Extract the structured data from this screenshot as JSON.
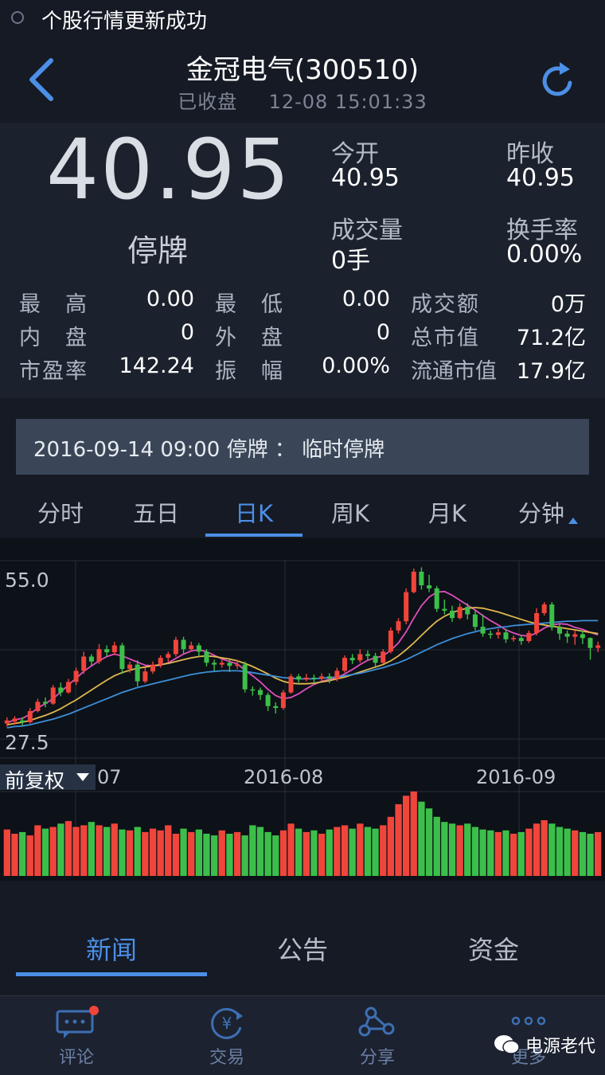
{
  "status_bar": {
    "message": "个股行情更新成功"
  },
  "header": {
    "title": "金冠电气(300510)",
    "status": "已收盘",
    "datetime": "12-08 15:01:33"
  },
  "quote": {
    "price": "40.95",
    "state": "停牌",
    "today_open_label": "今开",
    "today_open": "40.95",
    "prev_close_label": "昨收",
    "prev_close": "40.95",
    "volume_label": "成交量",
    "volume": "0手",
    "turnover_rate_label": "换手率",
    "turnover_rate": "0.00%"
  },
  "stats": [
    {
      "label": "最　高",
      "value": "0.00"
    },
    {
      "label": "最　低",
      "value": "0.00"
    },
    {
      "label": "成交额",
      "value": "0万"
    },
    {
      "label": "内　盘",
      "value": "0"
    },
    {
      "label": "外　盘",
      "value": "0"
    },
    {
      "label": "总市值",
      "value": "71.2亿"
    },
    {
      "label": "市盈率",
      "value": "142.24"
    },
    {
      "label": "振　幅",
      "value": "0.00%"
    },
    {
      "label": "流通市值",
      "value": "17.9亿"
    }
  ],
  "notice": {
    "date": "2016-09-14 09:00",
    "label": "停牌",
    "sep": "：",
    "text": "临时停牌"
  },
  "chart_tabs": [
    "分时",
    "五日",
    "日K",
    "周K",
    "月K",
    "分钟"
  ],
  "chart_tab_active": "日K",
  "chart_data": {
    "type": "bar",
    "ylabels": [
      "55.0",
      "27.5"
    ],
    "ylim": [
      27.5,
      55.0
    ],
    "xlabels": [
      "07",
      "2016-08",
      "2016-09"
    ],
    "candles": [
      [
        30,
        30.5,
        29.5,
        31
      ],
      [
        30.3,
        30.8,
        29.8,
        31.2
      ],
      [
        30.5,
        30.2,
        29.6,
        31
      ],
      [
        30.2,
        32,
        30,
        32.5
      ],
      [
        32,
        33.5,
        31.8,
        34
      ],
      [
        33.5,
        33.2,
        32.6,
        34.2
      ],
      [
        33.2,
        35.8,
        33,
        36.2
      ],
      [
        35.8,
        35,
        34.4,
        36.6
      ],
      [
        35,
        36.7,
        34.8,
        37.2
      ],
      [
        36.7,
        38.5,
        36.2,
        39
      ],
      [
        38.5,
        40.8,
        38,
        41.6
      ],
      [
        40.8,
        40,
        39.3,
        41.2
      ],
      [
        40,
        42,
        39.6,
        42.8
      ],
      [
        42,
        41.5,
        40.8,
        42.6
      ],
      [
        41.5,
        42.6,
        41,
        43.2
      ],
      [
        42.6,
        38.8,
        38,
        43
      ],
      [
        38.8,
        39.5,
        38.2,
        40
      ],
      [
        39.5,
        36.8,
        36,
        40.2
      ],
      [
        36.8,
        38.4,
        36.5,
        39
      ],
      [
        38.4,
        39.5,
        38,
        40
      ],
      [
        39.5,
        40.6,
        39,
        41
      ],
      [
        40.6,
        41.2,
        40,
        41.6
      ],
      [
        41.2,
        43.5,
        40.8,
        44
      ],
      [
        43.5,
        42,
        41.2,
        44
      ],
      [
        42,
        42.6,
        41.6,
        43.2
      ],
      [
        42.6,
        41.6,
        40.8,
        43
      ],
      [
        41.6,
        39.8,
        39.2,
        42
      ],
      [
        39.8,
        39.5,
        38.5,
        40.3
      ],
      [
        39.5,
        39.8,
        39,
        40.3
      ],
      [
        39.8,
        39.3,
        38.3,
        40.3
      ],
      [
        39.3,
        39.5,
        38.8,
        40.3
      ],
      [
        39.5,
        35.5,
        35,
        40
      ],
      [
        35.5,
        35.4,
        34.5,
        36
      ],
      [
        35.4,
        34.6,
        33.8,
        35.8
      ],
      [
        34.6,
        32.8,
        32,
        35
      ],
      [
        32.8,
        32.5,
        31.6,
        33.4
      ],
      [
        32.5,
        35,
        32.2,
        35.4
      ],
      [
        35,
        37.6,
        34.8,
        38
      ],
      [
        37.6,
        37.1,
        36.6,
        38
      ],
      [
        37.1,
        37.4,
        36.8,
        38
      ],
      [
        37.4,
        37.2,
        36.5,
        37.9
      ],
      [
        37.2,
        37.6,
        36.8,
        38.1
      ],
      [
        37.6,
        37.2,
        36.5,
        38.1
      ],
      [
        37.2,
        38.5,
        36.8,
        39
      ],
      [
        38.5,
        40.6,
        38.2,
        41
      ],
      [
        40.6,
        40.2,
        39.6,
        41.2
      ],
      [
        40.2,
        41.2,
        39.8,
        42
      ],
      [
        41.2,
        40.9,
        40.2,
        41.8
      ],
      [
        40.9,
        39.8,
        39.2,
        41.4
      ],
      [
        39.8,
        41.6,
        39.6,
        42
      ],
      [
        41.6,
        45,
        41.3,
        45.5
      ],
      [
        45,
        46.5,
        44.5,
        47
      ],
      [
        46.5,
        51.2,
        46,
        51.8
      ],
      [
        51.2,
        54.5,
        51,
        55
      ],
      [
        54.5,
        52.3,
        51.6,
        55.2
      ],
      [
        52.3,
        51.8,
        51.2,
        54
      ],
      [
        51.8,
        48.5,
        48,
        52.2
      ],
      [
        48.5,
        48.2,
        47.6,
        50
      ],
      [
        48.2,
        47,
        46.4,
        49
      ],
      [
        47,
        48.8,
        46.8,
        49.4
      ],
      [
        48.8,
        47.6,
        46.8,
        49.4
      ],
      [
        47.6,
        45.6,
        45,
        48.2
      ],
      [
        45.6,
        44.5,
        44,
        47.6
      ],
      [
        44.5,
        44.3,
        43.7,
        45
      ],
      [
        44.3,
        44.7,
        43.7,
        45.3
      ],
      [
        44.7,
        43.6,
        43,
        45.3
      ],
      [
        43.6,
        43.8,
        43.2,
        44.2
      ],
      [
        43.8,
        43.3,
        42.7,
        44.3
      ],
      [
        43.3,
        44.6,
        43,
        45
      ],
      [
        44.6,
        47.8,
        44.2,
        48.6
      ],
      [
        47.8,
        49.2,
        47.4,
        49.6
      ],
      [
        49.2,
        45.5,
        45,
        49.6
      ],
      [
        45.5,
        44.5,
        43.5,
        46
      ],
      [
        44.5,
        44,
        43,
        45
      ],
      [
        44,
        44.4,
        42.7,
        45
      ],
      [
        44.4,
        43.8,
        42.8,
        45
      ],
      [
        43.8,
        42.2,
        40.3,
        43.9
      ],
      [
        42.2,
        42.6,
        41.5,
        43.2
      ]
    ],
    "ma_series": [
      {
        "color": "#e04fbe",
        "values": [
          30.1,
          30.6,
          30.8,
          31.5,
          32.5,
          33.2,
          34.0,
          35.1,
          36.2,
          37.3,
          38.4,
          39.3,
          40.1,
          40.8,
          41.2,
          40.9,
          40.4,
          39.9,
          39.4,
          39.3,
          39.4,
          39.8,
          40.5,
          41.2,
          41.7,
          41.9,
          41.6,
          41.0,
          40.4,
          40.0,
          39.6,
          38.6,
          37.7,
          36.7,
          35.5,
          34.5,
          34.0,
          34.2,
          34.8,
          35.6,
          36.3,
          36.8,
          37.1,
          37.4,
          38.0,
          38.7,
          39.5,
          40.2,
          40.6,
          40.9,
          41.8,
          43.0,
          44.8,
          47.0,
          49.0,
          50.4,
          51.2,
          51.3,
          50.7,
          49.9,
          49.1,
          48.3,
          47.4,
          46.6,
          45.9,
          45.1,
          44.6,
          44.2,
          44.1,
          44.6,
          45.4,
          45.9,
          46.1,
          46.0,
          45.5,
          45.2,
          44.7,
          44.3
        ]
      },
      {
        "color": "#e0b84f",
        "values": [
          29.8,
          30.0,
          30.2,
          30.5,
          30.9,
          31.3,
          31.8,
          32.4,
          33.1,
          33.8,
          34.6,
          35.4,
          36.2,
          37.0,
          37.7,
          38.2,
          38.6,
          38.9,
          39.1,
          39.3,
          39.5,
          39.7,
          40.0,
          40.3,
          40.6,
          40.8,
          40.9,
          40.8,
          40.6,
          40.4,
          40.1,
          39.7,
          39.2,
          38.6,
          38.0,
          37.3,
          36.8,
          36.5,
          36.4,
          36.4,
          36.5,
          36.7,
          36.9,
          37.2,
          37.5,
          37.9,
          38.3,
          38.7,
          39.1,
          39.5,
          40.1,
          40.9,
          41.9,
          43.0,
          44.2,
          45.4,
          46.5,
          47.3,
          47.9,
          48.3,
          48.6,
          48.7,
          48.6,
          48.3,
          48.0,
          47.6,
          47.2,
          46.8,
          46.4,
          46.1,
          45.9,
          45.7,
          45.5,
          45.3,
          45.1,
          44.9,
          44.7,
          44.5
        ]
      },
      {
        "color": "#3c8fd8",
        "values": [
          29.3,
          29.5,
          29.6,
          29.8,
          30.1,
          30.4,
          30.7,
          31.1,
          31.5,
          32.0,
          32.5,
          33.0,
          33.5,
          34.0,
          34.5,
          35.0,
          35.4,
          35.8,
          36.1,
          36.4,
          36.7,
          37.0,
          37.3,
          37.6,
          37.9,
          38.1,
          38.3,
          38.4,
          38.5,
          38.5,
          38.5,
          38.4,
          38.2,
          38.0,
          37.8,
          37.6,
          37.4,
          37.3,
          37.2,
          37.2,
          37.2,
          37.3,
          37.4,
          37.5,
          37.7,
          37.9,
          38.1,
          38.4,
          38.7,
          39.0,
          39.4,
          39.8,
          40.3,
          40.9,
          41.5,
          42.1,
          42.7,
          43.2,
          43.7,
          44.1,
          44.5,
          44.8,
          45.1,
          45.3,
          45.5,
          45.6,
          45.8,
          45.9,
          46.0,
          46.1,
          46.2,
          46.3,
          46.4,
          46.5,
          46.5,
          46.6,
          46.6,
          46.6
        ]
      }
    ],
    "volumes": [
      55,
      50,
      52,
      48,
      60,
      56,
      58,
      62,
      65,
      58,
      60,
      64,
      60,
      58,
      62,
      55,
      54,
      58,
      52,
      56,
      54,
      60,
      50,
      56,
      52,
      55,
      50,
      48,
      54,
      50,
      52,
      48,
      60,
      58,
      52,
      48,
      54,
      62,
      56,
      52,
      54,
      50,
      55,
      58,
      60,
      56,
      62,
      58,
      56,
      60,
      70,
      85,
      95,
      100,
      88,
      80,
      70,
      64,
      62,
      60,
      62,
      58,
      55,
      54,
      52,
      54,
      50,
      52,
      56,
      62,
      66,
      62,
      58,
      56,
      54,
      52,
      50,
      52
    ],
    "vol_max": 100
  },
  "fq_label": "前复权",
  "bottom_tabs": [
    "新闻",
    "公告",
    "资金"
  ],
  "bottom_tab_active": "新闻",
  "navbar": [
    {
      "label": "评论",
      "icon": "comment-icon"
    },
    {
      "label": "交易",
      "icon": "trade-yen-icon"
    },
    {
      "label": "分享",
      "icon": "share-icon"
    },
    {
      "label": "更多",
      "icon": "more-icon"
    }
  ],
  "watermark": "电源老代",
  "colors": {
    "up": "#f0453b",
    "down": "#3cbf4a",
    "accent": "#4c8fe6"
  }
}
